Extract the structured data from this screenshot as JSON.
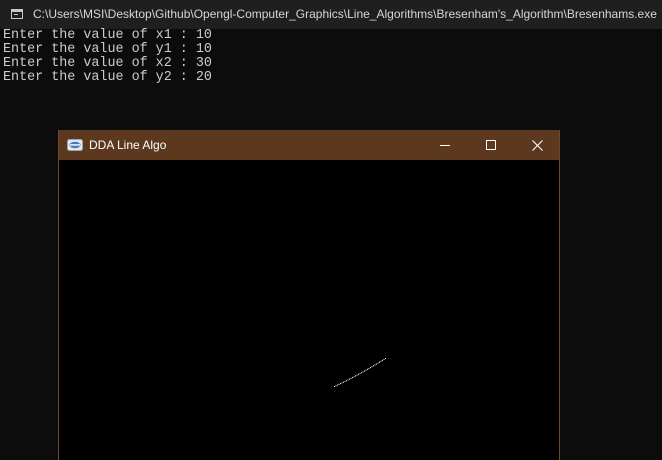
{
  "console": {
    "title": "C:\\Users\\MSI\\Desktop\\Github\\Opengl-Computer_Graphics\\Line_Algorithms\\Bresenham's_Algorithm\\Bresenhams.exe",
    "lines": [
      "Enter the value of x1 : 10",
      "Enter the value of y1 : 10",
      "Enter the value of x2 : 30",
      "Enter the value of y2 : 20"
    ]
  },
  "glut_window": {
    "title": "DDA Line Algo",
    "background_color": "#5c391e",
    "canvas_color": "#000000",
    "line_color": "#ffffff",
    "icons": {
      "app": "glut-app-icon",
      "minimize": "minimize-icon",
      "maximize": "maximize-icon",
      "close": "close-icon"
    }
  }
}
